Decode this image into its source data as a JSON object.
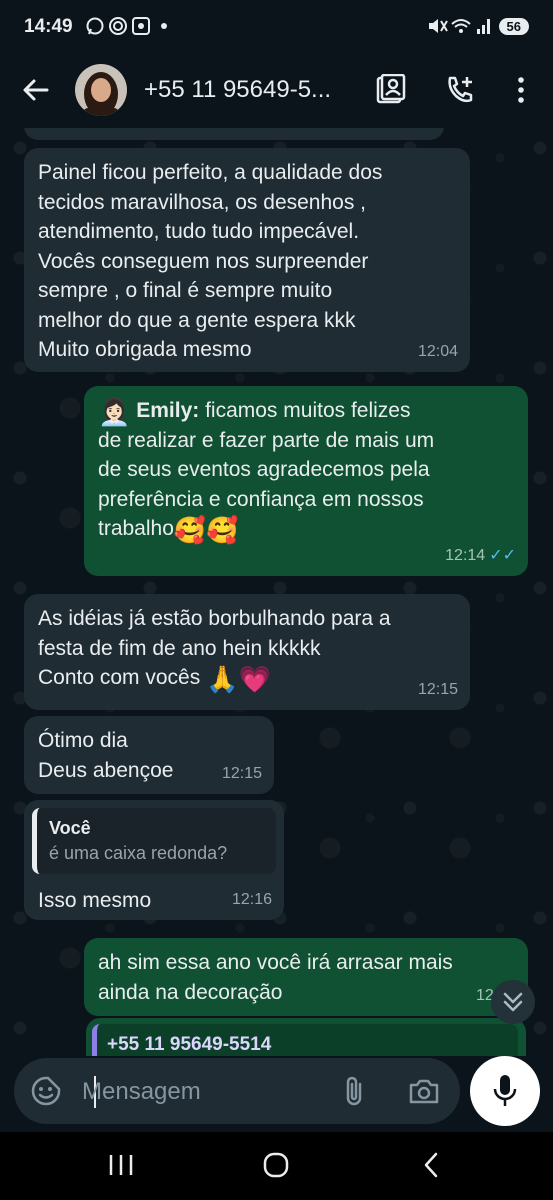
{
  "status_bar": {
    "time": "14:49",
    "battery": "56"
  },
  "header": {
    "contact_name": "+55 11 95649-5..."
  },
  "messages": [
    {
      "direction": "in",
      "lines": [
        "Painel ficou perfeito, a qualidade dos",
        "tecidos maravilhosa, os desenhos ,",
        "atendimento, tudo tudo impecável.",
        "Vocês conseguem nos surpreender",
        "sempre , o final é sempre muito",
        "melhor do que a gente espera kkk",
        "Muito obrigada mesmo"
      ],
      "time": "12:04"
    },
    {
      "direction": "out",
      "sender_emoji": "👩🏻‍💼",
      "sender": "Emily:",
      "first_line": " ficamos muitos felizes",
      "lines": [
        "de realizar e fazer parte de mais um",
        "de seus eventos agradecemos pela",
        "preferência e confiança em nossos"
      ],
      "last_line": "trabalho",
      "last_emoji": "🥰🥰",
      "time": "12:14",
      "ticks": "✓✓"
    },
    {
      "direction": "in",
      "lines": [
        "As idéias já estão borbulhando para a",
        "festa de fim de ano hein kkkkk"
      ],
      "last_line": "Conto com vocês ",
      "last_emoji": "🙏💗",
      "time": "12:15"
    },
    {
      "direction": "in",
      "lines": [
        "Ótimo dia",
        "Deus abençoe"
      ],
      "time": "12:15"
    },
    {
      "direction": "in",
      "quote_name": "Você",
      "quote_text": "é uma caixa redonda?",
      "lines": [
        "Isso mesmo"
      ],
      "time": "12:16"
    },
    {
      "direction": "out",
      "lines": [
        "ah sim essa ano você irá arrasar mais",
        "ainda na decoração"
      ],
      "time": "12:16"
    }
  ],
  "partial_quote": "+55 11 95649-5514",
  "composer": {
    "placeholder": "Mensagem"
  },
  "colors": {
    "background": "#0b141a",
    "incoming_bubble": "#1f2c34",
    "outgoing_bubble": "#0f5132",
    "read_ticks": "#53bdeb"
  }
}
